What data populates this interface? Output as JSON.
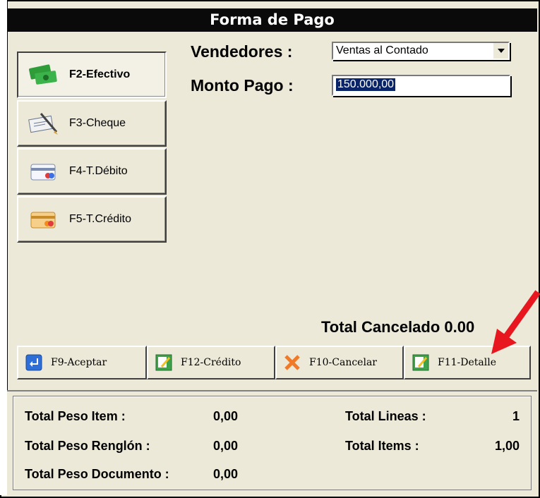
{
  "window": {
    "title": "Forma de Pago"
  },
  "payment_methods": [
    {
      "label": "F2-Efectivo",
      "icon": "cash-icon",
      "active": true
    },
    {
      "label": "F3-Cheque",
      "icon": "cheque-icon",
      "active": false
    },
    {
      "label": "F4-T.Débito",
      "icon": "debit-card-icon",
      "active": false
    },
    {
      "label": "F5-T.Crédito",
      "icon": "credit-card-icon",
      "active": false
    }
  ],
  "form": {
    "vendedores_label": "Vendedores :",
    "vendedores_value": "Ventas al Contado",
    "monto_label": "Monto Pago :",
    "monto_value": "150.000,00"
  },
  "total_cancelado": "Total Cancelado 0.00",
  "toolbar": {
    "aceptar": "F9-Aceptar",
    "credito": "F12-Crédito",
    "cancelar": "F10-Cancelar",
    "detalle": "F11-Detalle"
  },
  "status": {
    "peso_item_label": "Total Peso Item :",
    "peso_item_value": "0,00",
    "peso_renglon_label": "Total Peso Renglón  :",
    "peso_renglon_value": "0,00",
    "peso_documento_label": "Total Peso Documento :",
    "peso_documento_value": "0,00",
    "lineas_label": "Total Lineas  :",
    "lineas_value": "1",
    "items_label": "Total Items :",
    "items_value": "1,00"
  },
  "colors": {
    "selection": "#0a246a",
    "annotation_arrow": "#e8171f"
  }
}
